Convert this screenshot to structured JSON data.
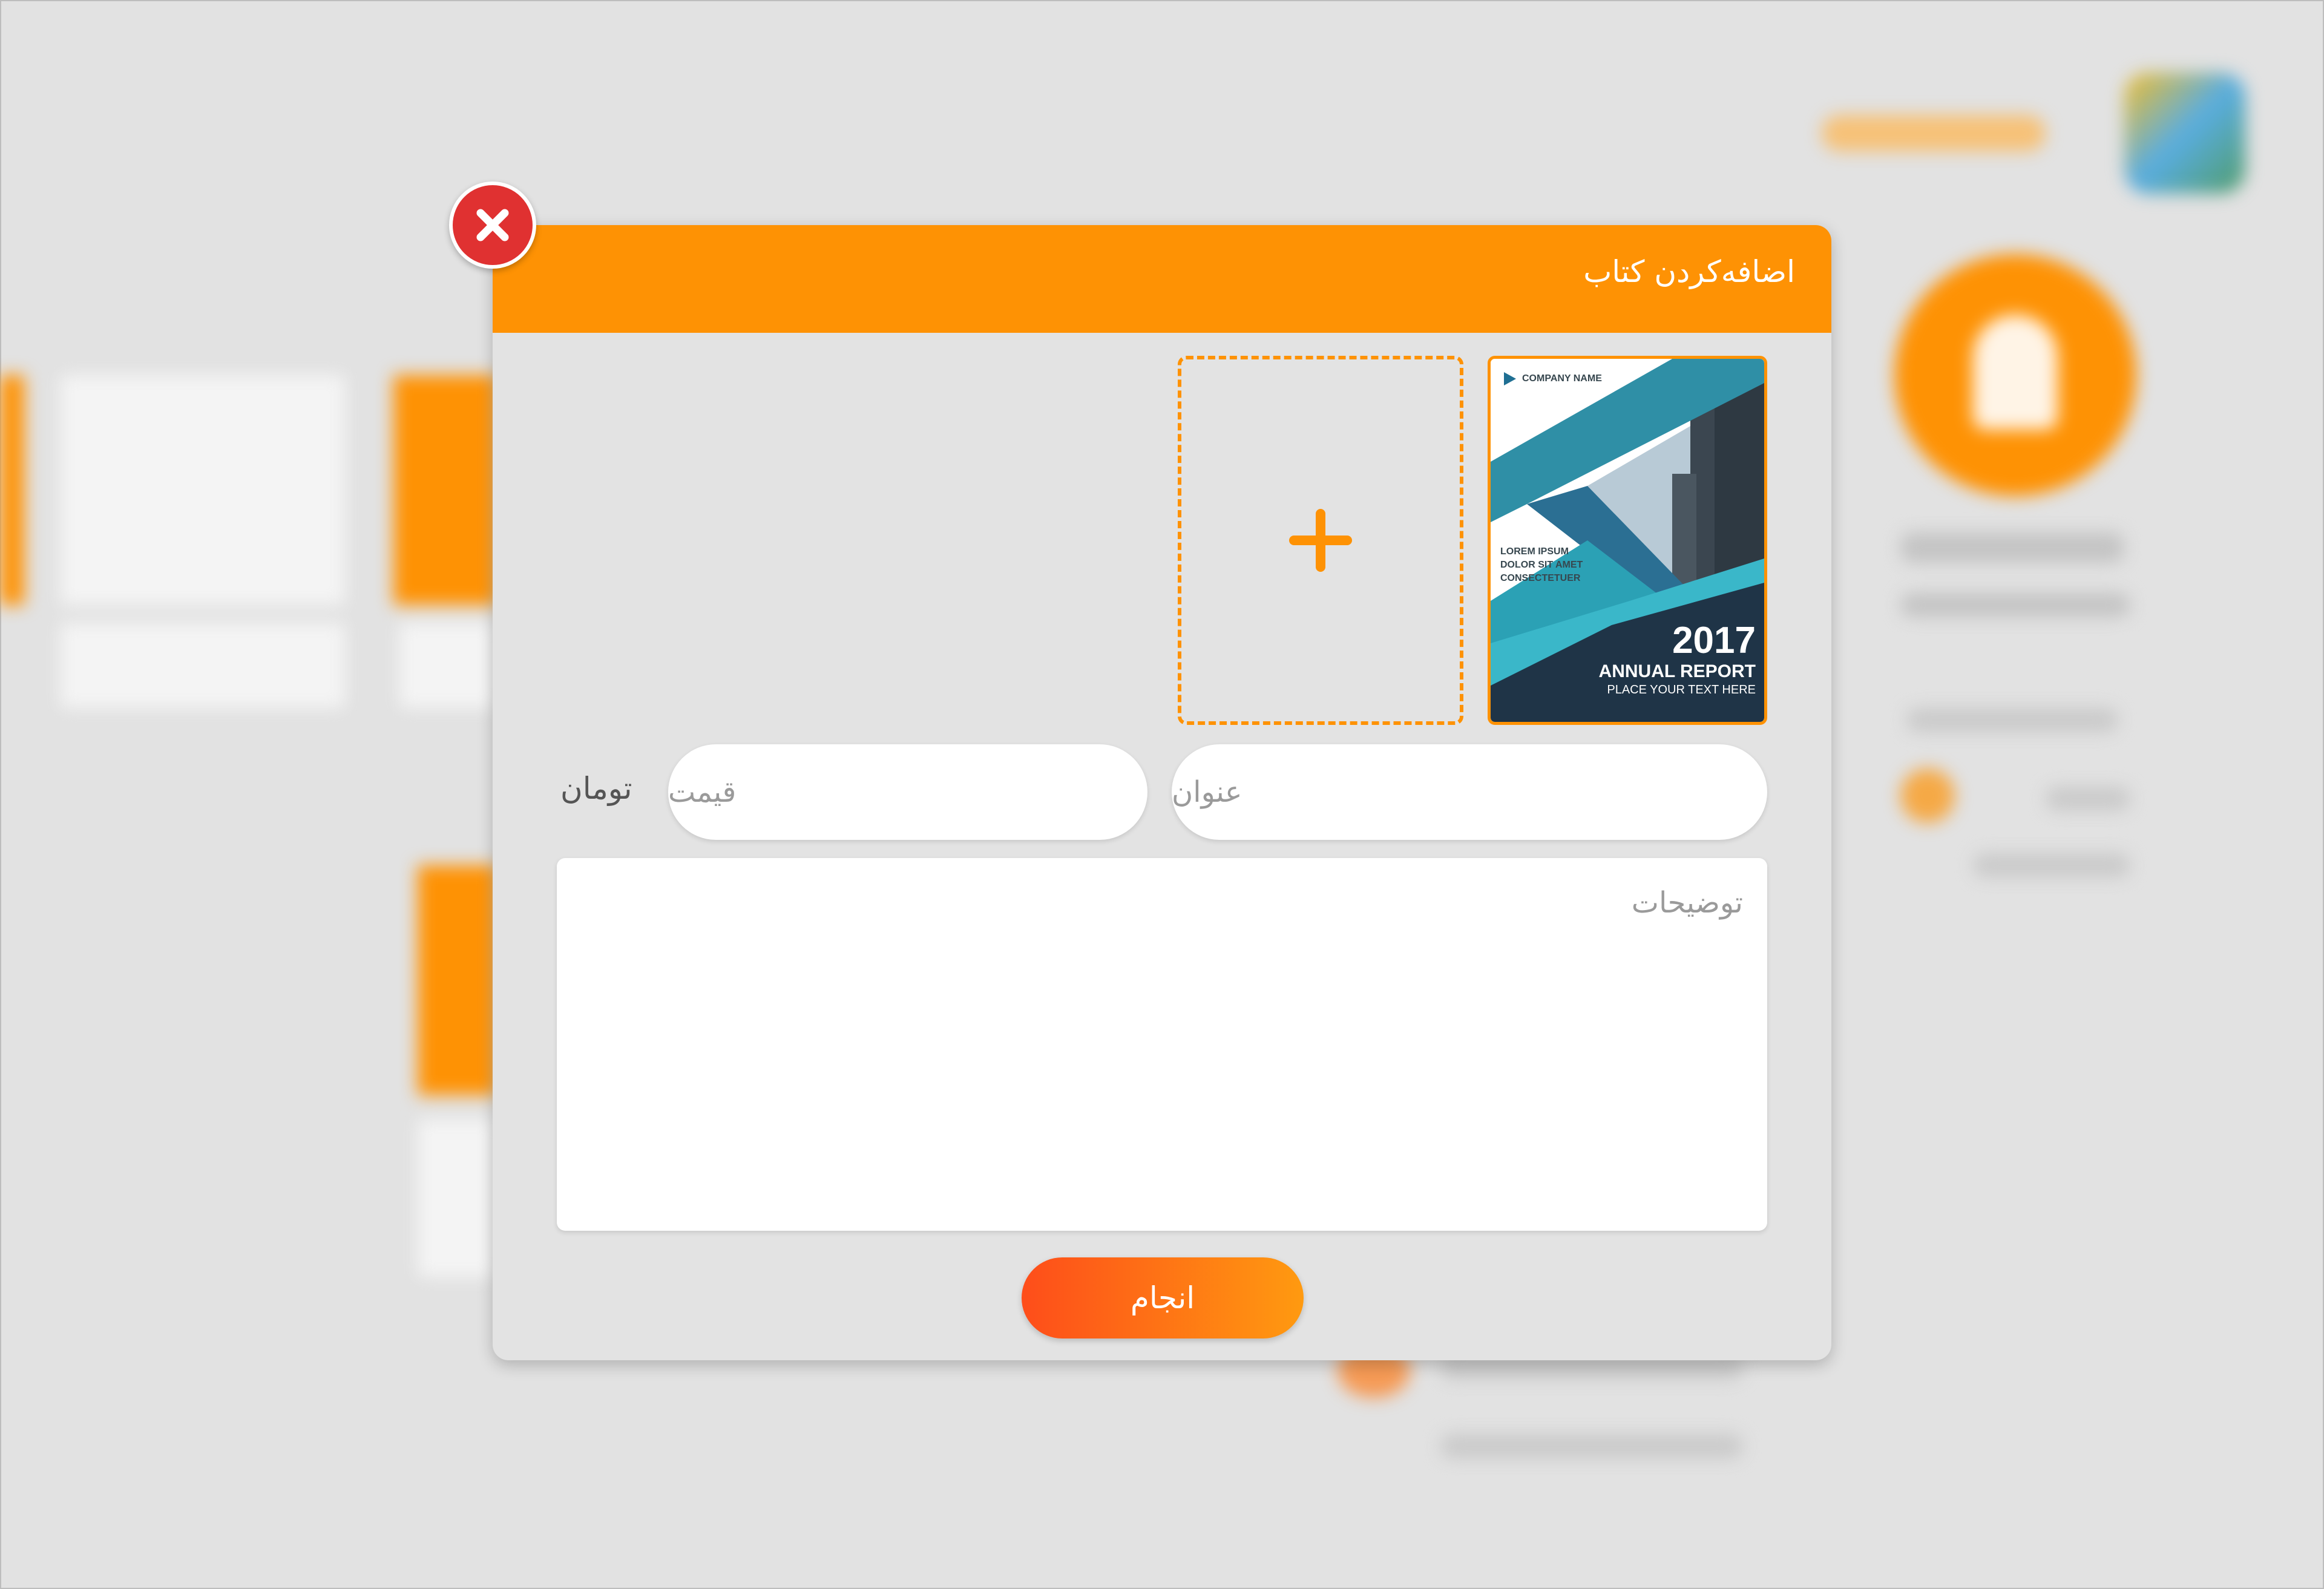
{
  "colors": {
    "accent": "#fe9204",
    "close": "#e03131",
    "button_start": "#fe4d1a",
    "button_end": "#ff9a10"
  },
  "modal": {
    "title": "اضافه‌کردن کتاب",
    "close_icon": "close-icon",
    "add_icon": "plus-icon",
    "cover": {
      "company": "COMPANY NAME",
      "lorem": [
        "LOREM IPSUM",
        "DOLOR SIT AMET",
        "CONSECTETUER"
      ],
      "year": "2017",
      "report": "ANNUAL REPORT",
      "place_text": "PLACE YOUR TEXT HERE"
    },
    "title_placeholder": "عنوان",
    "price_placeholder": "قیمت",
    "currency": "تومان",
    "description_placeholder": "توضیحات",
    "submit_label": "انجام"
  }
}
